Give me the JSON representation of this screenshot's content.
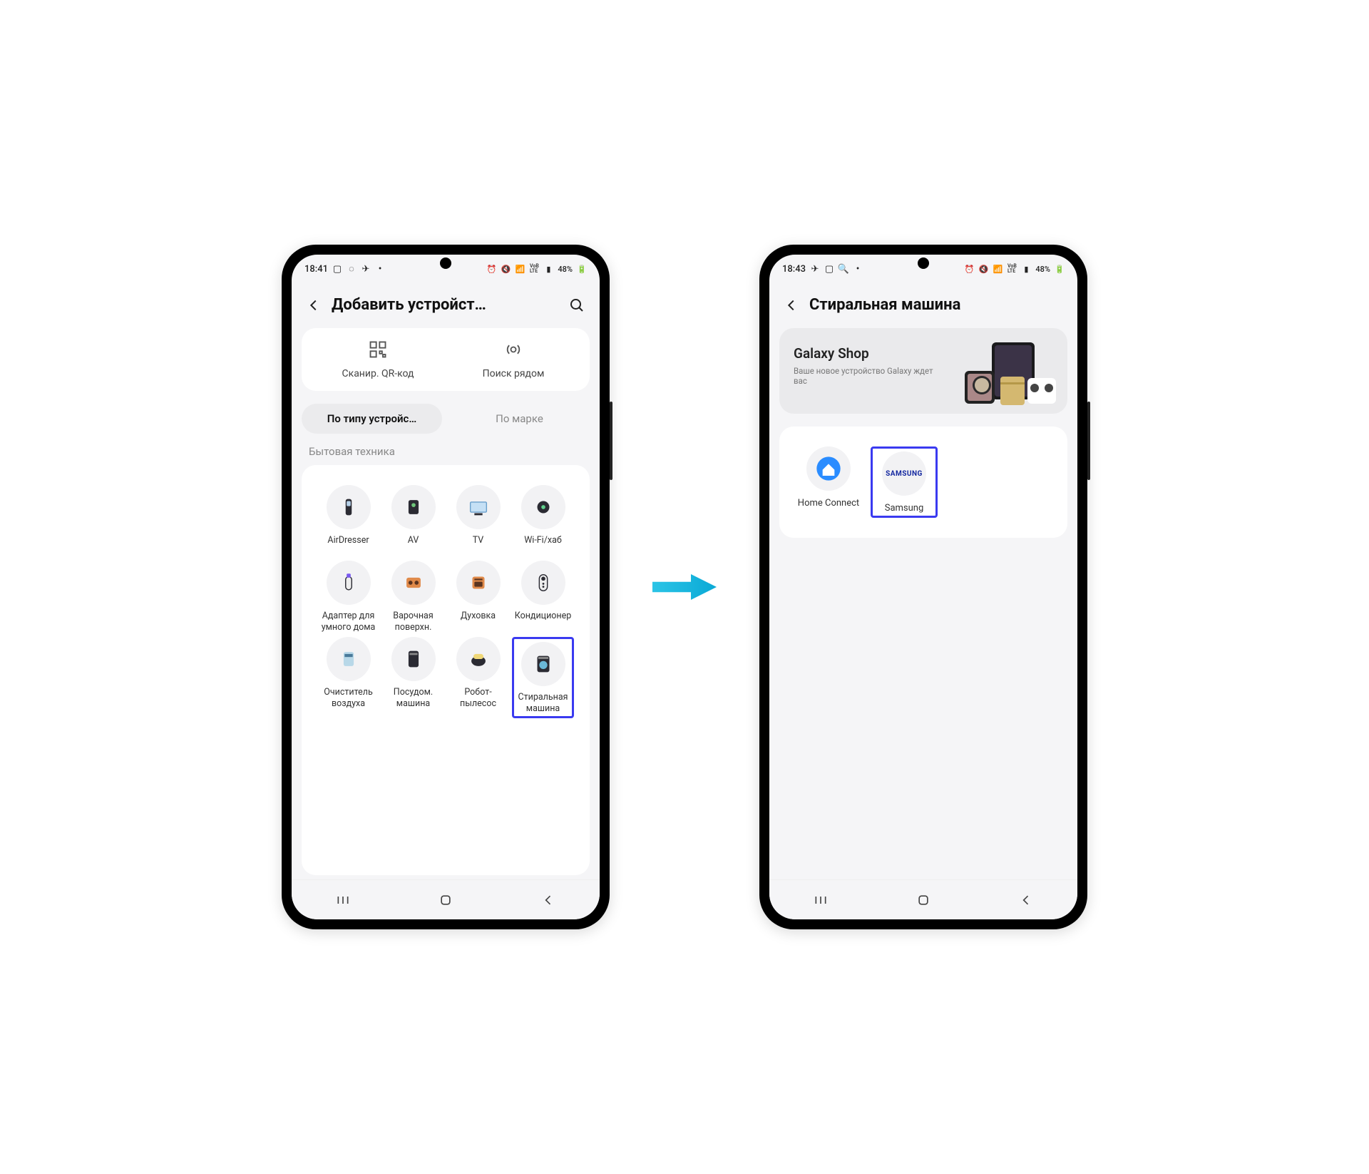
{
  "left": {
    "status": {
      "time": "18:41",
      "battery": "48%"
    },
    "title": "Добавить устройст…",
    "actions": {
      "qr": "Сканир. QR-код",
      "nearby": "Поиск рядом"
    },
    "tabs": {
      "by_type": "По типу устройс…",
      "by_brand": "По марке"
    },
    "section": "Бытовая техника",
    "devices": [
      {
        "label": "AirDresser",
        "icon": "airdresser"
      },
      {
        "label": "AV",
        "icon": "av"
      },
      {
        "label": "TV",
        "icon": "tv"
      },
      {
        "label": "Wi-Fi/хаб",
        "icon": "hub"
      },
      {
        "label": "Адаптер для умного дома",
        "icon": "adapter"
      },
      {
        "label": "Варочная поверхн.",
        "icon": "cooktop"
      },
      {
        "label": "Духовка",
        "icon": "oven"
      },
      {
        "label": "Кондиционер",
        "icon": "ac"
      },
      {
        "label": "Очиститель воздуха",
        "icon": "purifier"
      },
      {
        "label": "Посудом. машина",
        "icon": "dishwasher"
      },
      {
        "label": "Робот-пылесос",
        "icon": "robot"
      },
      {
        "label": "Стиральная машина",
        "icon": "washer",
        "highlight": true
      }
    ]
  },
  "right": {
    "status": {
      "time": "18:43",
      "battery": "48%"
    },
    "title": "Стиральная машина",
    "banner": {
      "title": "Galaxy Shop",
      "subtitle": "Ваше новое устройство Galaxy ждет вас"
    },
    "brands": [
      {
        "label": "Home Connect",
        "icon": "homeconnect"
      },
      {
        "label": "Samsung",
        "icon": "samsung",
        "highlight": true
      }
    ]
  }
}
